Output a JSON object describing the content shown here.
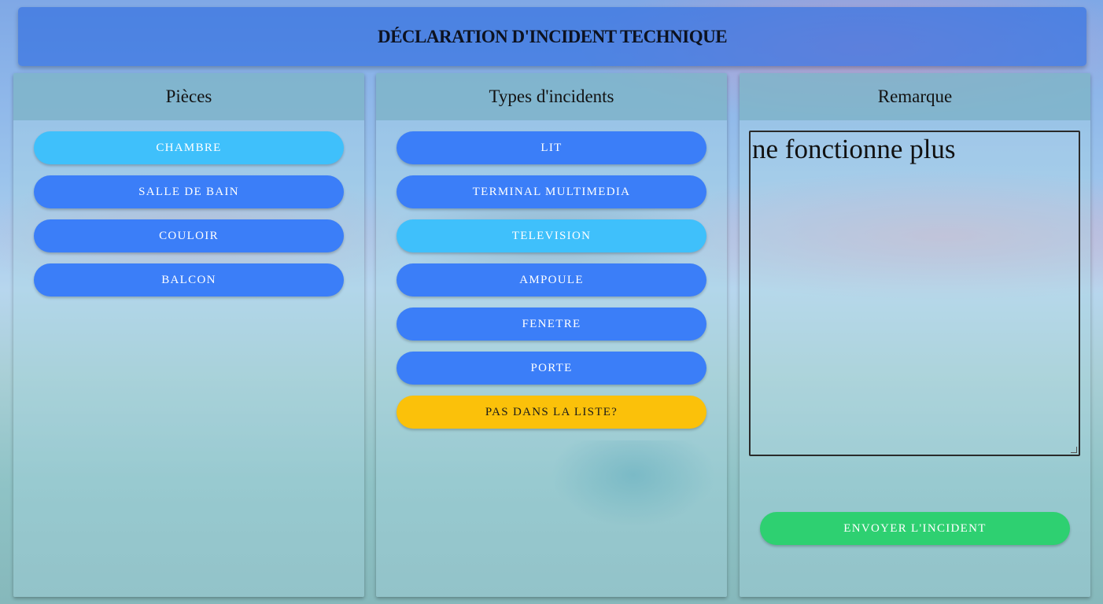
{
  "header": {
    "title": "DÉCLARATION D'INCIDENT TECHNIQUE"
  },
  "rooms": {
    "title": "Pièces",
    "items": [
      {
        "label": "CHAMBRE",
        "state": "selected"
      },
      {
        "label": "SALLE DE BAIN",
        "state": "default"
      },
      {
        "label": "COULOIR",
        "state": "default"
      },
      {
        "label": "BALCON",
        "state": "default"
      }
    ]
  },
  "incidents": {
    "title": "Types d'incidents",
    "items": [
      {
        "label": "LIT",
        "state": "default"
      },
      {
        "label": "TERMINAL MULTIMEDIA",
        "state": "default"
      },
      {
        "label": "TELEVISION",
        "state": "selected"
      },
      {
        "label": "AMPOULE",
        "state": "default"
      },
      {
        "label": "FENETRE",
        "state": "default"
      },
      {
        "label": "PORTE",
        "state": "default"
      }
    ],
    "other_label": "PAS DANS LA LISTE?"
  },
  "remark": {
    "title": "Remarque",
    "value": "ne fonctionne plus",
    "send_label": "ENVOYER L'INCIDENT"
  },
  "colors": {
    "button_default": "#3b7ef8",
    "button_selected": "#3fc0fb",
    "button_other": "#fbc10a",
    "button_send": "#2ed071"
  }
}
